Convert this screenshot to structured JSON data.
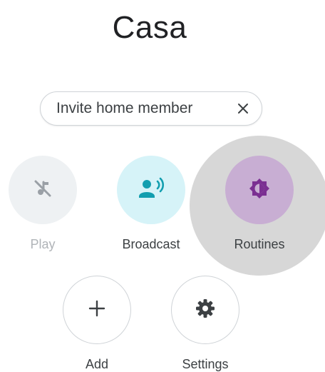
{
  "home": {
    "name": "Casa"
  },
  "invite_chip": {
    "label": "Invite home member",
    "close_icon": "close-icon"
  },
  "actions": [
    {
      "id": "play",
      "label": "Play",
      "icon": "music-off-icon",
      "enabled": false,
      "color": "#9aa0a6"
    },
    {
      "id": "broadcast",
      "label": "Broadcast",
      "icon": "broadcast-icon",
      "enabled": true,
      "color": "#129eaf"
    },
    {
      "id": "routines",
      "label": "Routines",
      "icon": "routines-icon",
      "enabled": true,
      "color": "#7b2f92",
      "pressed": true
    },
    {
      "id": "add",
      "label": "Add",
      "icon": "plus-icon",
      "enabled": true,
      "color": "#3c4043"
    },
    {
      "id": "settings",
      "label": "Settings",
      "icon": "gear-icon",
      "enabled": true,
      "color": "#3c4043"
    }
  ]
}
